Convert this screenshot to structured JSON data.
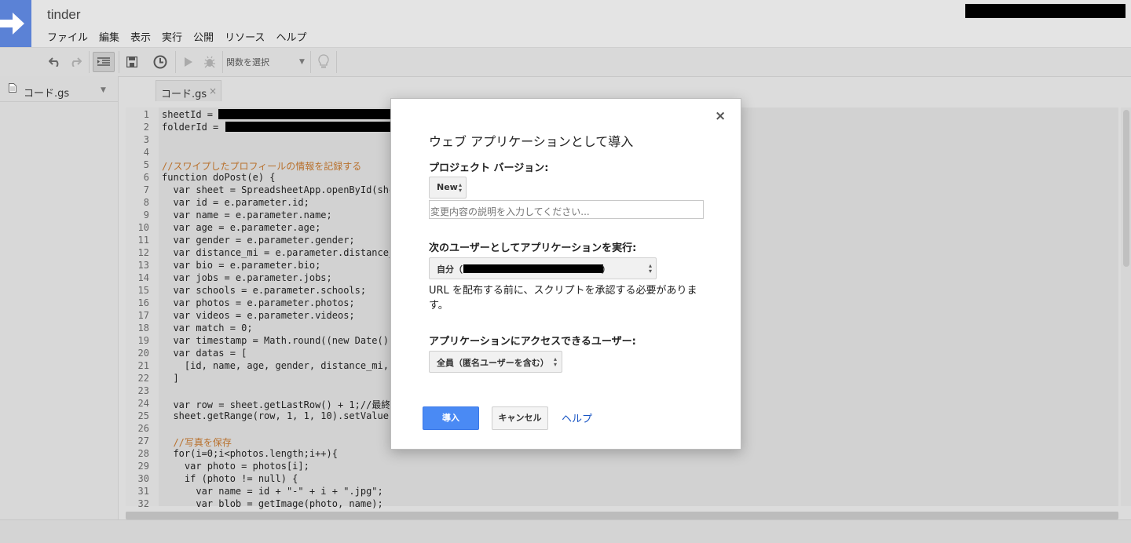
{
  "app": {
    "project_title": "tinder",
    "menu": [
      "ファイル",
      "編集",
      "表示",
      "実行",
      "公開",
      "リソース",
      "ヘルプ"
    ],
    "brand_color": "#5b82d6"
  },
  "toolbar": {
    "function_select": "関数を選択",
    "icons": [
      "undo-icon",
      "redo-icon",
      "indent-icon",
      "save-icon",
      "triggers-icon",
      "run-icon",
      "debug-icon",
      "lightbulb-icon"
    ]
  },
  "sidebar": {
    "file_name": "コード.gs"
  },
  "editor": {
    "tab_label": "コード.gs",
    "tab_close": "×",
    "line_numbers": [
      "1",
      "2",
      "3",
      "4",
      "5",
      "6",
      "7",
      "8",
      "9",
      "10",
      "11",
      "12",
      "13",
      "14",
      "15",
      "16",
      "17",
      "18",
      "19",
      "20",
      "21",
      "22",
      "23",
      "24",
      "25",
      "26",
      "27",
      "28",
      "29",
      "30",
      "31",
      "32"
    ],
    "lines": [
      "sheetId = ",
      "folderId = ",
      "",
      "",
      "//スワイプしたプロフィールの情報を記録する",
      "function doPost(e) {",
      "  var sheet = SpreadsheetApp.openById(she",
      "  var id = e.parameter.id;",
      "  var name = e.parameter.name;",
      "  var age = e.parameter.age;",
      "  var gender = e.parameter.gender;",
      "  var distance_mi = e.parameter.distance_",
      "  var bio = e.parameter.bio;",
      "  var jobs = e.parameter.jobs;",
      "  var schools = e.parameter.schools;",
      "  var photos = e.parameter.photos;",
      "  var videos = e.parameter.videos;",
      "  var match = 0;",
      "  var timestamp = Math.round((new Date()",
      "  var datas = [",
      "    [id, name, age, gender, distance_mi,",
      "  ]",
      "",
      "  var row = sheet.getLastRow() + 1;//最終",
      "  sheet.getRange(row, 1, 1, 10).setValues",
      "",
      "  //写真を保存",
      "  for(i=0;i<photos.length;i++){",
      "    var photo = photos[i];",
      "    if (photo != null) {",
      "      var name = id + \"-\" + i + \".jpg\";",
      "      var blob = getImage(photo, name);"
    ]
  },
  "dialog": {
    "title": "ウェブ アプリケーションとして導入",
    "close": "×",
    "project_version_label": "プロジェクト バージョン:",
    "version_value": "New",
    "description_placeholder": "変更内容の説明を入力してください...",
    "execute_as_label": "次のユーザーとしてアプリケーションを実行:",
    "execute_as_prefix": "自分（",
    "execute_as_suffix": "）",
    "url_note": "URL を配布する前に、スクリプトを承認する必要があります。",
    "access_label": "アプリケーションにアクセスできるユーザー:",
    "access_value": "全員（匿名ユーザーを含む）",
    "deploy_button": "導入",
    "cancel_button": "キャンセル",
    "help_link": "ヘルプ",
    "primary_color": "#4a8af4",
    "link_color": "#1a56c4"
  }
}
